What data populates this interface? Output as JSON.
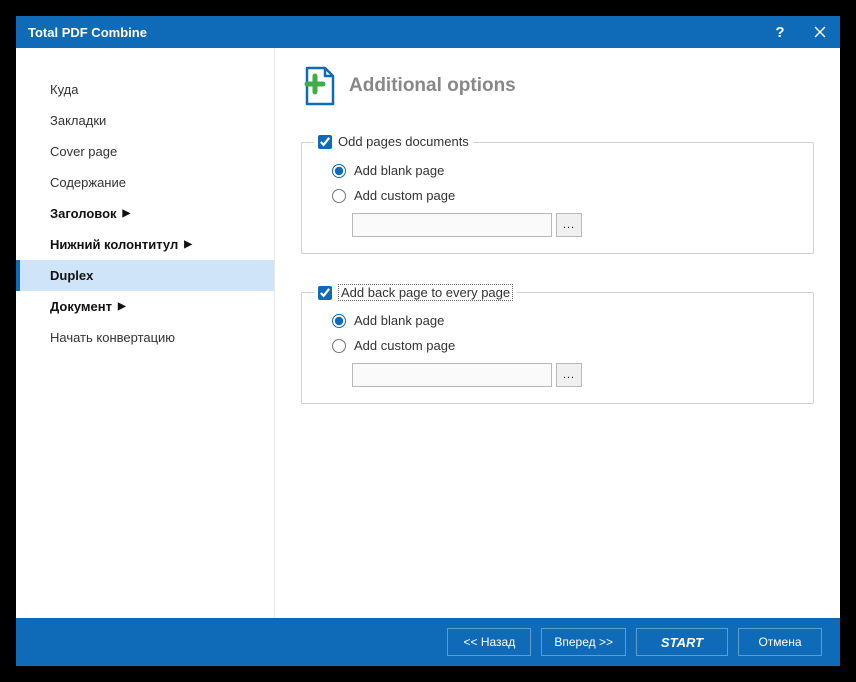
{
  "titlebar": {
    "title": "Total PDF Combine"
  },
  "sidebar": {
    "items": [
      {
        "label": "Куда",
        "bold": false,
        "chevron": false
      },
      {
        "label": "Закладки",
        "bold": false,
        "chevron": false
      },
      {
        "label": "Cover page",
        "bold": false,
        "chevron": false
      },
      {
        "label": "Содержание",
        "bold": false,
        "chevron": false
      },
      {
        "label": "Заголовок",
        "bold": true,
        "chevron": true
      },
      {
        "label": "Нижний колонтитул",
        "bold": true,
        "chevron": true
      },
      {
        "label": "Duplex",
        "bold": true,
        "chevron": false,
        "selected": true
      },
      {
        "label": "Документ",
        "bold": true,
        "chevron": true
      },
      {
        "label": "Начать конвертацию",
        "bold": false,
        "chevron": false
      }
    ]
  },
  "main": {
    "heading": "Additional options",
    "group1": {
      "legend": "Odd pages documents",
      "checked": true,
      "opt_blank": "Add blank page",
      "opt_custom": "Add custom page",
      "browse": "..."
    },
    "group2": {
      "legend": "Add back page to every page",
      "checked": true,
      "opt_blank": "Add blank page",
      "opt_custom": "Add custom page",
      "browse": "..."
    }
  },
  "footer": {
    "back": "<<  Назад",
    "forward": "Вперед  >>",
    "start": "START",
    "cancel": "Отмена"
  }
}
